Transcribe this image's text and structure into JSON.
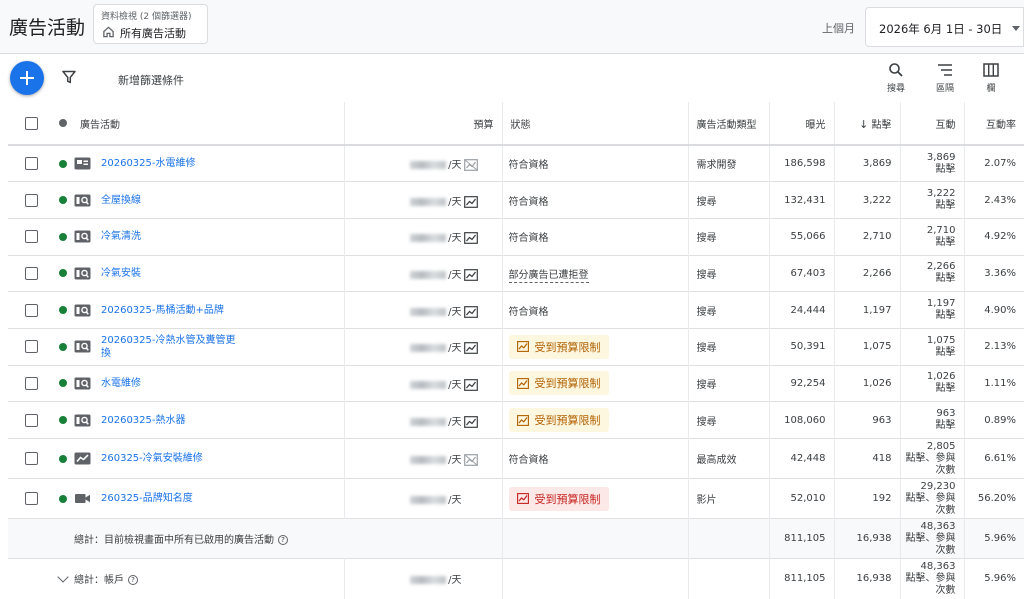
{
  "header": {
    "title": "廣告活動",
    "view_label": "資料檢視 (2 個篩選器)",
    "view_value": "所有廣告活動",
    "range_label": "上個月",
    "date_range": "2026年 6月 1日 - 30日"
  },
  "toolbar": {
    "add_filter": "新增篩選條件",
    "search": "搜尋",
    "segment": "區隔",
    "columns": "欄"
  },
  "columns": {
    "campaign": "廣告活動",
    "budget": "預算",
    "status": "狀態",
    "type": "廣告活動類型",
    "impressions": "曝光",
    "clicks": "點擊",
    "interactions": "互動",
    "rate": "互動率"
  },
  "rows": [
    {
      "name": "20260325-水電維修",
      "per": "/天",
      "status": "符合資格",
      "type": "需求開發",
      "imp": "186,598",
      "clk": "3,869",
      "int1": "3,869",
      "int2": "點擊",
      "int3": "",
      "rate": "2.07%"
    },
    {
      "name": "全屋換線",
      "per": "/天",
      "status": "符合資格",
      "type": "搜尋",
      "imp": "132,431",
      "clk": "3,222",
      "int1": "3,222",
      "int2": "點擊",
      "int3": "",
      "rate": "2.43%"
    },
    {
      "name": "冷氣清洗",
      "per": "/天",
      "status": "符合資格",
      "type": "搜尋",
      "imp": "55,066",
      "clk": "2,710",
      "int1": "2,710",
      "int2": "點擊",
      "int3": "",
      "rate": "4.92%"
    },
    {
      "name": "冷氣安裝",
      "per": "/天",
      "status": "部分廣告已遭拒登",
      "type": "搜尋",
      "imp": "67,403",
      "clk": "2,266",
      "int1": "2,266",
      "int2": "點擊",
      "int3": "",
      "rate": "3.36%"
    },
    {
      "name": "20260325-馬桶活動+品牌",
      "per": "/天",
      "status": "符合資格",
      "type": "搜尋",
      "imp": "24,444",
      "clk": "1,197",
      "int1": "1,197",
      "int2": "點擊",
      "int3": "",
      "rate": "4.90%"
    },
    {
      "name_l1": "20260325-冷熱水管及糞管更",
      "name_l2": "換",
      "per": "/天",
      "status": "受到預算限制",
      "type": "搜尋",
      "imp": "50,391",
      "clk": "1,075",
      "int1": "1,075",
      "int2": "點擊",
      "int3": "",
      "rate": "2.13%"
    },
    {
      "name": "水電維修",
      "per": "/天",
      "status": "受到預算限制",
      "type": "搜尋",
      "imp": "92,254",
      "clk": "1,026",
      "int1": "1,026",
      "int2": "點擊",
      "int3": "",
      "rate": "1.11%"
    },
    {
      "name": "20260325-熱水器",
      "per": "/天",
      "status": "受到預算限制",
      "type": "搜尋",
      "imp": "108,060",
      "clk": "963",
      "int1": "963",
      "int2": "點擊",
      "int3": "",
      "rate": "0.89%"
    },
    {
      "name": "260325-冷氣安裝維修",
      "per": "/天",
      "status": "符合資格",
      "type": "最高成效",
      "imp": "42,448",
      "clk": "418",
      "int1": "2,805",
      "int2": "點擊、參與",
      "int3": "次數",
      "rate": "6.61%"
    },
    {
      "name": "260325-品牌知名度",
      "per": "/天",
      "status": "受到預算限制",
      "type": "影片",
      "imp": "52,010",
      "clk": "192",
      "int1": "29,230",
      "int2": "點擊、參與",
      "int3": "次數",
      "rate": "56.20%"
    }
  ],
  "totals": {
    "enabled_label": "總計：目前檢視畫面中所有已啟用的廣告活動",
    "enabled": {
      "imp": "811,105",
      "clk": "16,938",
      "int1": "48,363",
      "int2": "點擊、參與",
      "int3": "次數",
      "rate": "5.96%"
    },
    "account_label": "總計：帳戶",
    "account_per": "/天",
    "account": {
      "imp": "811,105",
      "clk": "16,938",
      "int1": "48,363",
      "int2": "點擊、參與",
      "int3": "次數",
      "rate": "5.96%"
    }
  },
  "colors": {
    "accent": "#1a73e8",
    "enabled_dot": "#188038",
    "limited_bg": "#fef7e0",
    "limited_text": "#b06000",
    "limited_red_bg": "#fce8e6",
    "limited_red_text": "#c5221f"
  },
  "icons": [
    "home-icon",
    "plus-icon",
    "filter-icon",
    "search-icon",
    "segment-icon",
    "columns-icon",
    "checkbox-icon",
    "status-dot-icon",
    "demand-gen-icon",
    "search-campaign-icon",
    "performance-max-icon",
    "video-icon",
    "budget-chart-icon",
    "help-icon",
    "expand-icon"
  ]
}
